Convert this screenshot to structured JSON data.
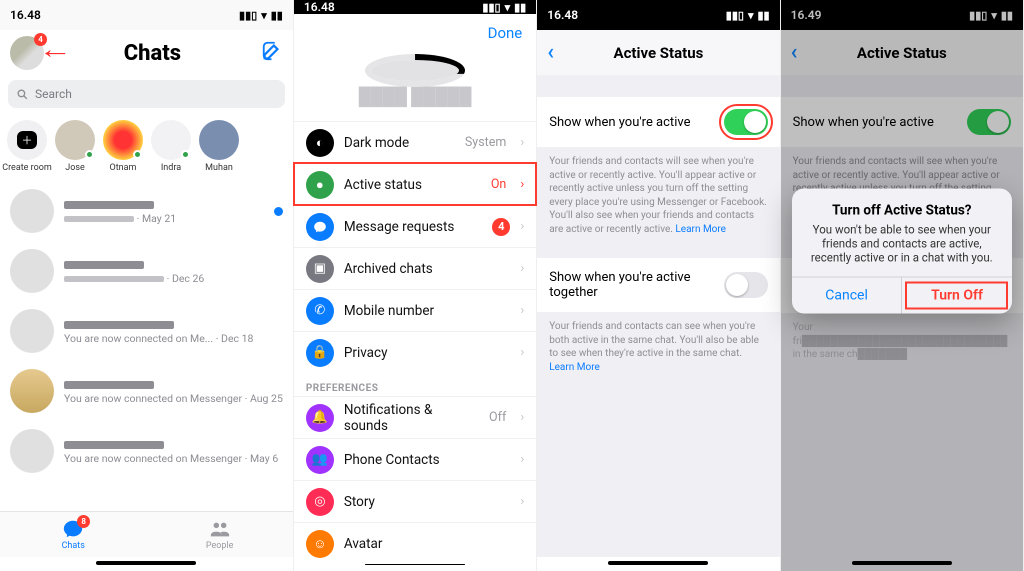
{
  "screens": {
    "s1": {
      "time": "16.48",
      "title": "Chats",
      "profile_badge": "4",
      "search_placeholder": "Search",
      "stories": [
        {
          "name": "Create room",
          "create": true
        },
        {
          "name": "Jose",
          "online": true
        },
        {
          "name": "Otnam",
          "online": true
        },
        {
          "name": "Indra",
          "online": true
        },
        {
          "name": "Muhan",
          "online": false
        }
      ],
      "chats": [
        {
          "date": "May 21",
          "unread": true
        },
        {
          "date": "Dec 26",
          "unread": false
        },
        {
          "sub": "You are now connected on Me...",
          "date": "Dec 18",
          "unread": false
        },
        {
          "sub": "You are now connected on Messenger",
          "date": "Aug 25",
          "unread": false
        },
        {
          "sub": "You are now connected on Messenger",
          "date": "May 6",
          "unread": false
        }
      ],
      "tabs": {
        "chats": "Chats",
        "people": "People",
        "chat_badge": "8"
      }
    },
    "s2": {
      "time": "16.48",
      "done": "Done",
      "profile_name": "████ █████",
      "items": [
        {
          "icon": "dark",
          "bg": "#000",
          "label": "Dark mode",
          "value": "System"
        },
        {
          "icon": "active",
          "bg": "#31a24c",
          "label": "Active status",
          "value": "On",
          "highlight": true
        },
        {
          "icon": "chat",
          "bg": "#0a7cff",
          "label": "Message requests",
          "badge": "4"
        },
        {
          "icon": "archive",
          "bg": "#787880",
          "label": "Archived chats"
        },
        {
          "icon": "phone",
          "bg": "#0a7cff",
          "label": "Mobile number"
        },
        {
          "icon": "lock",
          "bg": "#0a7cff",
          "label": "Privacy"
        }
      ],
      "section": "PREFERENCES",
      "items2": [
        {
          "icon": "bell",
          "bg": "#a033ff",
          "label": "Notifications & sounds",
          "value": "Off"
        },
        {
          "icon": "contacts",
          "bg": "#a033ff",
          "label": "Phone Contacts"
        },
        {
          "icon": "story",
          "bg": "#ff2d55",
          "label": "Story"
        },
        {
          "icon": "avatar",
          "bg": "#ff7a00",
          "label": "Avatar"
        }
      ]
    },
    "s3": {
      "time": "16.48",
      "title": "Active Status",
      "row1_label": "Show when you're active",
      "row1_on": true,
      "row1_desc": "Your friends and contacts will see when you're active or recently active. You'll appear active or recently active unless you turn off the setting every place you're using Messenger or Facebook. You'll also see when your friends and contacts are active or recently active.",
      "row2_label": "Show when you're active together",
      "row2_on": false,
      "row2_desc": "Your friends and contacts can see when you're both active in the same chat. You'll also be able to see when they're active in the same chat.",
      "learn_more": "Learn More"
    },
    "s4": {
      "time": "16.49",
      "title": "Active Status",
      "alert_title": "Turn off Active Status?",
      "alert_msg": "You won't be able to see when your friends and contacts are active, recently active or in a chat with you.",
      "cancel": "Cancel",
      "turn_off": "Turn Off"
    }
  }
}
